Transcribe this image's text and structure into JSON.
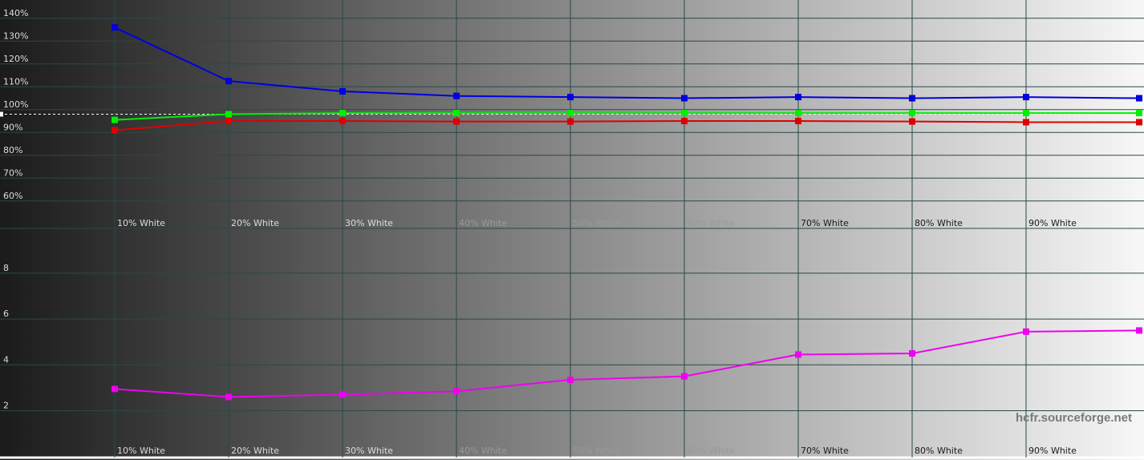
{
  "chart_data": [
    {
      "type": "line",
      "panel": "rgb-balance",
      "categories": [
        "10% White",
        "20% White",
        "30% White",
        "40% White",
        "50% White",
        "60% White",
        "70% White",
        "80% White",
        "90% White",
        ""
      ],
      "yticks": [
        "140%",
        "130%",
        "120%",
        "110%",
        "100%",
        "90%",
        "80%",
        "70%",
        "60%"
      ],
      "ylim": [
        57,
        145
      ],
      "reference": 98,
      "grid": true,
      "series": [
        {
          "color": "#0000e0",
          "values": [
            136,
            112.5,
            108,
            106,
            105.5,
            105,
            105.5,
            105,
            105.5,
            105
          ]
        },
        {
          "color": "#00f000",
          "values": [
            95.5,
            98,
            98.5,
            98.5,
            98.5,
            98.5,
            98.5,
            98.5,
            98.5,
            98.5
          ]
        },
        {
          "color": "#e00000",
          "values": [
            91,
            95,
            95,
            94.8,
            94.8,
            95,
            95,
            94.8,
            94.5,
            94.5
          ]
        }
      ]
    },
    {
      "type": "line",
      "panel": "delta-e",
      "categories": [
        "10% White",
        "20% White",
        "30% White",
        "40% White",
        "50% White",
        "60% White",
        "70% White",
        "80% White",
        "90% White",
        ""
      ],
      "yticks": [
        "8",
        "6",
        "4",
        "2"
      ],
      "ylim": [
        0.2,
        9
      ],
      "grid": true,
      "series": [
        {
          "color": "#f000f0",
          "values": [
            2.95,
            2.6,
            2.7,
            2.85,
            3.35,
            3.5,
            4.45,
            4.5,
            5.45,
            5.5
          ]
        }
      ]
    }
  ],
  "watermark": "hcfr.sourceforge.net"
}
